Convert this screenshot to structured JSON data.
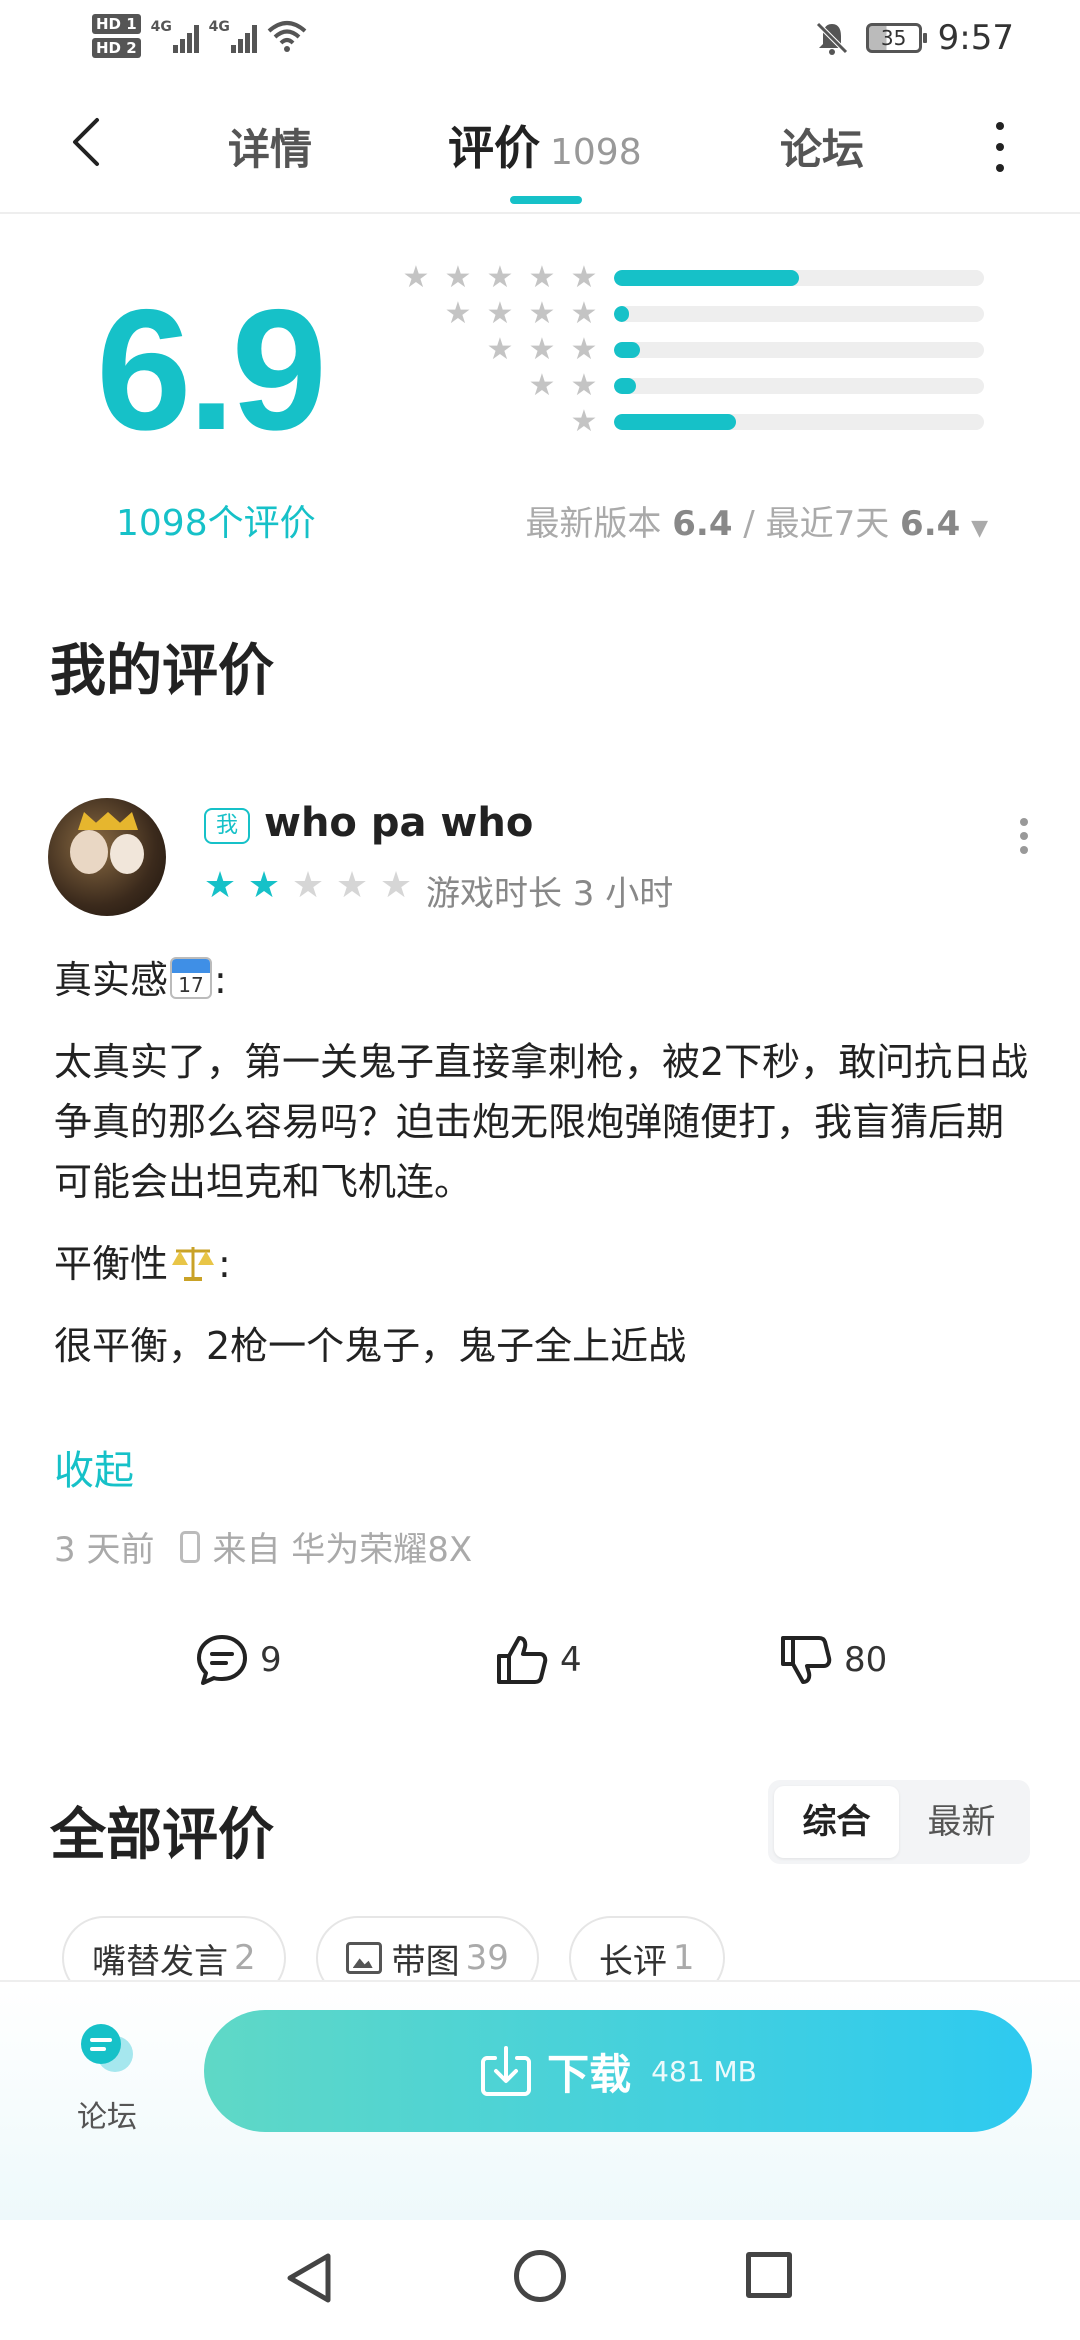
{
  "status_bar": {
    "hd1": "HD 1",
    "hd2": "HD 2",
    "net1": "4G",
    "net2": "4G",
    "battery": "35",
    "time": "9:57"
  },
  "header": {
    "tabs": [
      {
        "label": "详情"
      },
      {
        "label": "评价",
        "count": "1098"
      },
      {
        "label": "论坛"
      }
    ]
  },
  "rating": {
    "score": "6.9",
    "count_label": "1098个评价",
    "distribution": [
      {
        "stars": 5,
        "fraction": 0.5
      },
      {
        "stars": 4,
        "fraction": 0.04
      },
      {
        "stars": 3,
        "fraction": 0.07
      },
      {
        "stars": 2,
        "fraction": 0.06
      },
      {
        "stars": 1,
        "fraction": 0.33
      }
    ],
    "latest_version_label": "最新版本",
    "latest_version_score": "6.4",
    "separator": "/",
    "recent_label": "最近7天",
    "recent_score": "6.4"
  },
  "my_review": {
    "section_title": "我的评价",
    "me_badge": "我",
    "username": "who pa who",
    "stars": 2,
    "max_stars": 5,
    "playtime": "游戏时长 3 小时",
    "heading1": "真实感",
    "body1": "太真实了，第一关鬼子直接拿刺枪，被2下秒，敢问抗日战争真的那么容易吗？迫击炮无限炮弹随便打，我盲猜后期可能会出坦克和飞机连。",
    "heading2": "平衡性",
    "body2": "很平衡，2枪一个鬼子，鬼子全上近战",
    "collapse": "收起",
    "time_ago": "3 天前",
    "device": "来自 华为荣耀8X",
    "comments": "9",
    "likes": "4",
    "dislikes": "80"
  },
  "all_reviews": {
    "section_title": "全部评价",
    "sort_options": [
      "综合",
      "最新"
    ],
    "active_sort": "综合",
    "chips": [
      {
        "label": "嘴替发言",
        "count": "2"
      },
      {
        "label": "带图",
        "count": "39"
      },
      {
        "label": "长评",
        "count": "1"
      }
    ]
  },
  "bottom_bar": {
    "forum_label": "论坛",
    "download_label": "下载",
    "download_size": "481 MB"
  },
  "colors": {
    "accent": "#16c1c8",
    "download_start": "#5fd8c6",
    "download_end": "#2ecaf0"
  }
}
